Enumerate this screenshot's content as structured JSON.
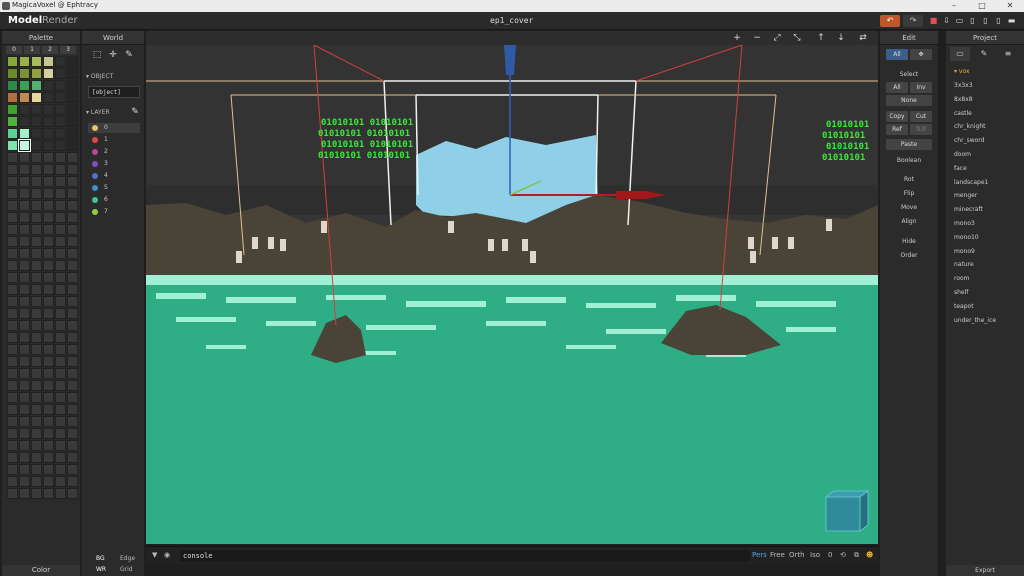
{
  "window": {
    "title": "MagicaVoxel @ Ephtracy",
    "minimize": "–",
    "maximize": "□",
    "close": "✕"
  },
  "menubar": {
    "mode_model": "Model",
    "mode_render": "Render",
    "file_title": "ep1_cover",
    "undo": "↶",
    "redo": "↷"
  },
  "palette": {
    "header": "Palette",
    "tabs": [
      "0",
      "1",
      "2",
      "3"
    ],
    "footer": "Color",
    "colors": [
      "#8aa83a",
      "#9bb04a",
      "#aabc5a",
      "#c4c890",
      "#2e2e2e",
      "#262626",
      "#6b8a2a",
      "#7b9238",
      "#94a040",
      "#d8d0a0",
      "#2e2e2e",
      "#262626",
      "#2f8a4a",
      "#3aa058",
      "#52b070",
      "#2e2e2e",
      "#2e2e2e",
      "#262626",
      "#b07040",
      "#c08a50",
      "#e8d8a0",
      "#2e2e2e",
      "#2e2e2e",
      "#262626",
      "#40a030",
      "#2e2e2e",
      "#2e2e2e",
      "#2e2e2e",
      "#2e2e2e",
      "#262626",
      "#50b040",
      "#2e2e2e",
      "#2e2e2e",
      "#2e2e2e",
      "#2e2e2e",
      "#262626",
      "#60d090",
      "#a0f0c8",
      "#2e2e2e",
      "#2e2e2e",
      "#2e2e2e",
      "#262626",
      "#80e0b0",
      "#c0f8e0",
      "#2e2e2e",
      "#2e2e2e",
      "#2e2e2e",
      "#262626"
    ]
  },
  "world": {
    "header": "World",
    "object_section": "OBJECT",
    "object_value": "[object]",
    "layer_section": "LAYER",
    "layers": [
      {
        "num": "0",
        "color": "#e8c070"
      },
      {
        "num": "1",
        "color": "#e04848"
      },
      {
        "num": "2",
        "color": "#c040a0"
      },
      {
        "num": "3",
        "color": "#8050c0"
      },
      {
        "num": "4",
        "color": "#5070d0"
      },
      {
        "num": "5",
        "color": "#4090d0"
      },
      {
        "num": "6",
        "color": "#40c0a0"
      },
      {
        "num": "7",
        "color": "#90d040"
      }
    ],
    "bg_label": "BG",
    "edge_label": "Edge",
    "wr_label": "WR",
    "grid_label": "Grid"
  },
  "viewport": {
    "binary_text": [
      "01010101  01010101",
      "01010101  01010101",
      "01010101  01010101",
      "01010101  01010101"
    ],
    "binary_text_right": [
      "01010101",
      "01010101",
      "01010101",
      "01010101"
    ],
    "zoom_in": "+",
    "zoom_out": "−"
  },
  "console": {
    "placeholder": "console",
    "pers": "Pers",
    "free": "Free",
    "orth": "Orth",
    "iso": "Iso",
    "value": "0"
  },
  "edit": {
    "header": "Edit",
    "all_tab": "All",
    "select_label": "Select",
    "all": "All",
    "inv": "Inv",
    "none": "None",
    "copy": "Copy",
    "cut": "Cut",
    "ref": "Ref",
    "ref_val": "0.0",
    "paste": "Paste",
    "boolean": "Boolean",
    "rot": "Rot",
    "flip": "Flip",
    "move": "Move",
    "align": "Align",
    "hide": "Hide",
    "order": "Order"
  },
  "project": {
    "header": "Project",
    "section": "vox",
    "items": [
      "3x3x3",
      "8x8x8",
      "castle",
      "chr_knight",
      "chr_sword",
      "doom",
      "face",
      "landscape1",
      "menger",
      "minecraft",
      "mono3",
      "mono10",
      "mono9",
      "nature",
      "room",
      "shelf",
      "teapot",
      "under_the_ice"
    ],
    "footer": "Export"
  }
}
